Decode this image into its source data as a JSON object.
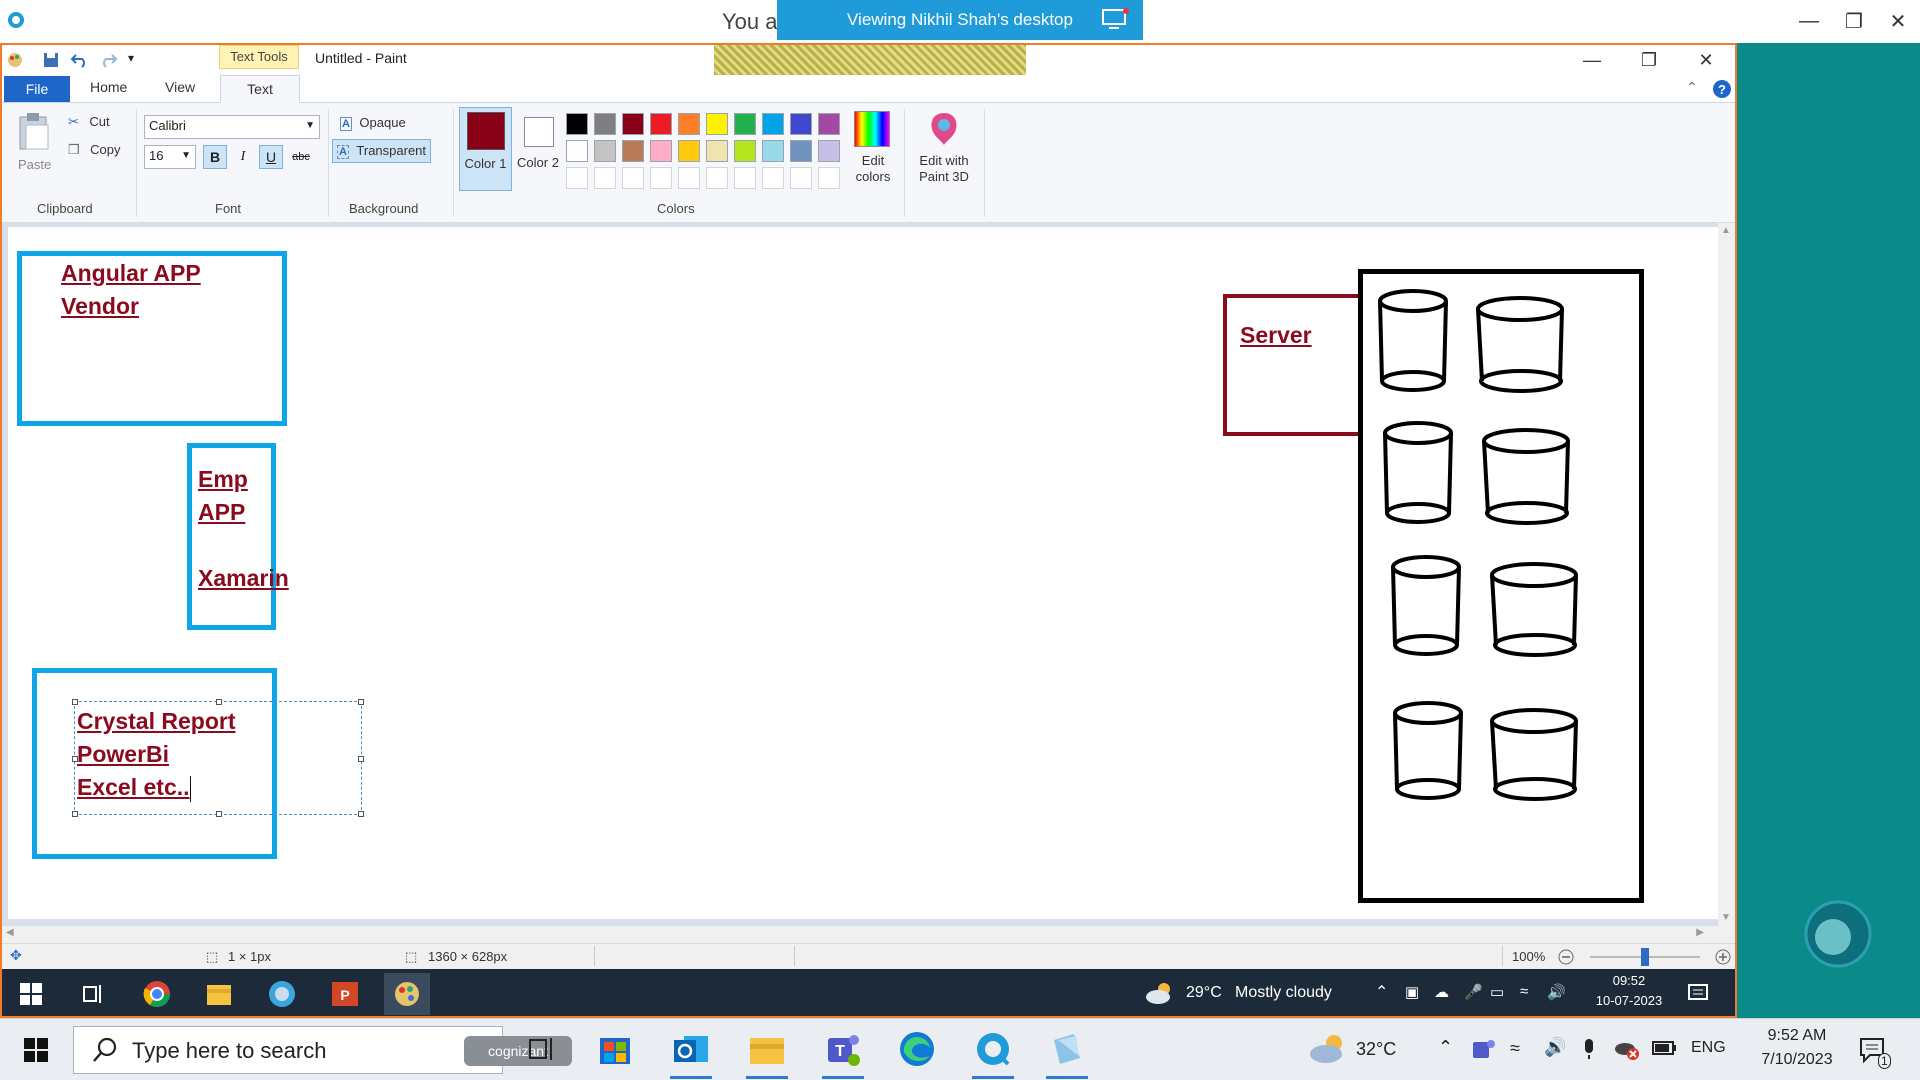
{
  "outer": {
    "title_partial": "You a",
    "banner": "Viewing Nikhil Shah's desktop"
  },
  "paint": {
    "title": "Untitled - Paint",
    "context_tab": "Text Tools",
    "tabs": {
      "file": "File",
      "home": "Home",
      "view": "View",
      "text": "Text"
    },
    "clipboard": {
      "paste": "Paste",
      "cut": "Cut",
      "copy": "Copy",
      "group": "Clipboard"
    },
    "font": {
      "family": "Calibri",
      "size": "16",
      "bold": "B",
      "italic": "I",
      "underline": "U",
      "strike": "abc",
      "group": "Font"
    },
    "background": {
      "opaque": "Opaque",
      "transparent": "Transparent",
      "group": "Background"
    },
    "colors": {
      "color1_label": "Color 1",
      "color2_label": "Color 2",
      "color1": "#880015",
      "color2": "#ffffff",
      "edit_colors": "Edit colors",
      "edit_paint3d": "Edit with Paint 3D",
      "group": "Colors",
      "palette_row1": [
        "#000000",
        "#7f7f7f",
        "#880015",
        "#ed1c24",
        "#ff7f27",
        "#fff200",
        "#22b14c",
        "#00a2e8",
        "#3f48cc",
        "#a349a4"
      ],
      "palette_row2": [
        "#ffffff",
        "#c3c3c3",
        "#b97a57",
        "#ffaec9",
        "#ffc90e",
        "#efe4b0",
        "#b5e61d",
        "#99d9ea",
        "#7092be",
        "#c8bfe7"
      ]
    },
    "canvas_text": {
      "angular_line1": "Angular APP",
      "angular_line2": "Vendor",
      "emp_line1": "Emp",
      "emp_line2": "APP",
      "emp_line3": "Xamarin",
      "report_line1": "Crystal Report",
      "report_line2": "PowerBi",
      "report_line3": "Excel etc..",
      "server": "Server"
    },
    "status": {
      "selection": "1 × 1px",
      "canvas_size": "1360 × 628px",
      "zoom": "100%"
    }
  },
  "remote_taskbar": {
    "weather_temp": "29°C",
    "weather_desc": "Mostly cloudy",
    "time": "09:52",
    "date": "10-07-2023"
  },
  "local_taskbar": {
    "search_placeholder": "Type here to search",
    "cognizant": "cognizant",
    "weather_temp": "32°C",
    "lang": "ENG",
    "time": "9:52 AM",
    "date": "7/10/2023",
    "notifications": "1"
  }
}
